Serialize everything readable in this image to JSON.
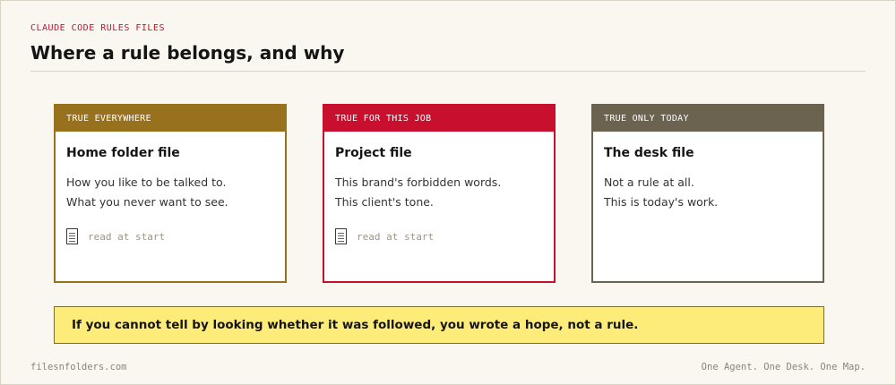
{
  "header": {
    "eyebrow": "CLAUDE CODE RULES FILES",
    "title": "Where a rule belongs, and why"
  },
  "cards": [
    {
      "tag": "TRUE EVERYWHERE",
      "title": "Home folder file",
      "lines": [
        "How you like to be talked to.",
        "What you never want to see."
      ],
      "read_label": "read at start",
      "color": "#98711e"
    },
    {
      "tag": "TRUE FOR THIS JOB",
      "title": "Project file",
      "lines": [
        "This brand's forbidden words.",
        "This client's tone."
      ],
      "read_label": "read at start",
      "color": "#c8102e"
    },
    {
      "tag": "TRUE ONLY TODAY",
      "title": "The desk file",
      "lines": [
        "Not a rule at all.",
        "This is today's work."
      ],
      "color": "#6b6350"
    }
  ],
  "icons": {
    "read_icon": "document-icon"
  },
  "callout": {
    "text": "If you cannot tell by looking whether it was followed, you wrote a hope, not a rule.",
    "color": "#fdec7a"
  },
  "footer": {
    "left": "filesnfolders.com",
    "right": "One Agent. One Desk. One Map."
  }
}
